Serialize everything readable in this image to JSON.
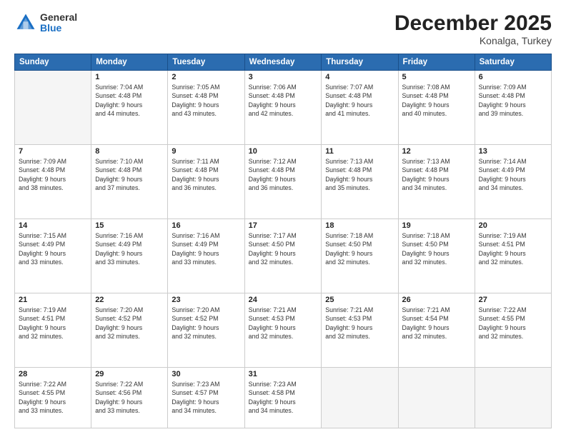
{
  "header": {
    "logo_general": "General",
    "logo_blue": "Blue",
    "month": "December 2025",
    "location": "Konalga, Turkey"
  },
  "days_of_week": [
    "Sunday",
    "Monday",
    "Tuesday",
    "Wednesday",
    "Thursday",
    "Friday",
    "Saturday"
  ],
  "weeks": [
    [
      {
        "day": "",
        "info": ""
      },
      {
        "day": "1",
        "info": "Sunrise: 7:04 AM\nSunset: 4:48 PM\nDaylight: 9 hours\nand 44 minutes."
      },
      {
        "day": "2",
        "info": "Sunrise: 7:05 AM\nSunset: 4:48 PM\nDaylight: 9 hours\nand 43 minutes."
      },
      {
        "day": "3",
        "info": "Sunrise: 7:06 AM\nSunset: 4:48 PM\nDaylight: 9 hours\nand 42 minutes."
      },
      {
        "day": "4",
        "info": "Sunrise: 7:07 AM\nSunset: 4:48 PM\nDaylight: 9 hours\nand 41 minutes."
      },
      {
        "day": "5",
        "info": "Sunrise: 7:08 AM\nSunset: 4:48 PM\nDaylight: 9 hours\nand 40 minutes."
      },
      {
        "day": "6",
        "info": "Sunrise: 7:09 AM\nSunset: 4:48 PM\nDaylight: 9 hours\nand 39 minutes."
      }
    ],
    [
      {
        "day": "7",
        "info": "Sunrise: 7:09 AM\nSunset: 4:48 PM\nDaylight: 9 hours\nand 38 minutes."
      },
      {
        "day": "8",
        "info": "Sunrise: 7:10 AM\nSunset: 4:48 PM\nDaylight: 9 hours\nand 37 minutes."
      },
      {
        "day": "9",
        "info": "Sunrise: 7:11 AM\nSunset: 4:48 PM\nDaylight: 9 hours\nand 36 minutes."
      },
      {
        "day": "10",
        "info": "Sunrise: 7:12 AM\nSunset: 4:48 PM\nDaylight: 9 hours\nand 36 minutes."
      },
      {
        "day": "11",
        "info": "Sunrise: 7:13 AM\nSunset: 4:48 PM\nDaylight: 9 hours\nand 35 minutes."
      },
      {
        "day": "12",
        "info": "Sunrise: 7:13 AM\nSunset: 4:48 PM\nDaylight: 9 hours\nand 34 minutes."
      },
      {
        "day": "13",
        "info": "Sunrise: 7:14 AM\nSunset: 4:49 PM\nDaylight: 9 hours\nand 34 minutes."
      }
    ],
    [
      {
        "day": "14",
        "info": "Sunrise: 7:15 AM\nSunset: 4:49 PM\nDaylight: 9 hours\nand 33 minutes."
      },
      {
        "day": "15",
        "info": "Sunrise: 7:16 AM\nSunset: 4:49 PM\nDaylight: 9 hours\nand 33 minutes."
      },
      {
        "day": "16",
        "info": "Sunrise: 7:16 AM\nSunset: 4:49 PM\nDaylight: 9 hours\nand 33 minutes."
      },
      {
        "day": "17",
        "info": "Sunrise: 7:17 AM\nSunset: 4:50 PM\nDaylight: 9 hours\nand 32 minutes."
      },
      {
        "day": "18",
        "info": "Sunrise: 7:18 AM\nSunset: 4:50 PM\nDaylight: 9 hours\nand 32 minutes."
      },
      {
        "day": "19",
        "info": "Sunrise: 7:18 AM\nSunset: 4:50 PM\nDaylight: 9 hours\nand 32 minutes."
      },
      {
        "day": "20",
        "info": "Sunrise: 7:19 AM\nSunset: 4:51 PM\nDaylight: 9 hours\nand 32 minutes."
      }
    ],
    [
      {
        "day": "21",
        "info": "Sunrise: 7:19 AM\nSunset: 4:51 PM\nDaylight: 9 hours\nand 32 minutes."
      },
      {
        "day": "22",
        "info": "Sunrise: 7:20 AM\nSunset: 4:52 PM\nDaylight: 9 hours\nand 32 minutes."
      },
      {
        "day": "23",
        "info": "Sunrise: 7:20 AM\nSunset: 4:52 PM\nDaylight: 9 hours\nand 32 minutes."
      },
      {
        "day": "24",
        "info": "Sunrise: 7:21 AM\nSunset: 4:53 PM\nDaylight: 9 hours\nand 32 minutes."
      },
      {
        "day": "25",
        "info": "Sunrise: 7:21 AM\nSunset: 4:53 PM\nDaylight: 9 hours\nand 32 minutes."
      },
      {
        "day": "26",
        "info": "Sunrise: 7:21 AM\nSunset: 4:54 PM\nDaylight: 9 hours\nand 32 minutes."
      },
      {
        "day": "27",
        "info": "Sunrise: 7:22 AM\nSunset: 4:55 PM\nDaylight: 9 hours\nand 32 minutes."
      }
    ],
    [
      {
        "day": "28",
        "info": "Sunrise: 7:22 AM\nSunset: 4:55 PM\nDaylight: 9 hours\nand 33 minutes."
      },
      {
        "day": "29",
        "info": "Sunrise: 7:22 AM\nSunset: 4:56 PM\nDaylight: 9 hours\nand 33 minutes."
      },
      {
        "day": "30",
        "info": "Sunrise: 7:23 AM\nSunset: 4:57 PM\nDaylight: 9 hours\nand 34 minutes."
      },
      {
        "day": "31",
        "info": "Sunrise: 7:23 AM\nSunset: 4:58 PM\nDaylight: 9 hours\nand 34 minutes."
      },
      {
        "day": "",
        "info": ""
      },
      {
        "day": "",
        "info": ""
      },
      {
        "day": "",
        "info": ""
      }
    ]
  ]
}
